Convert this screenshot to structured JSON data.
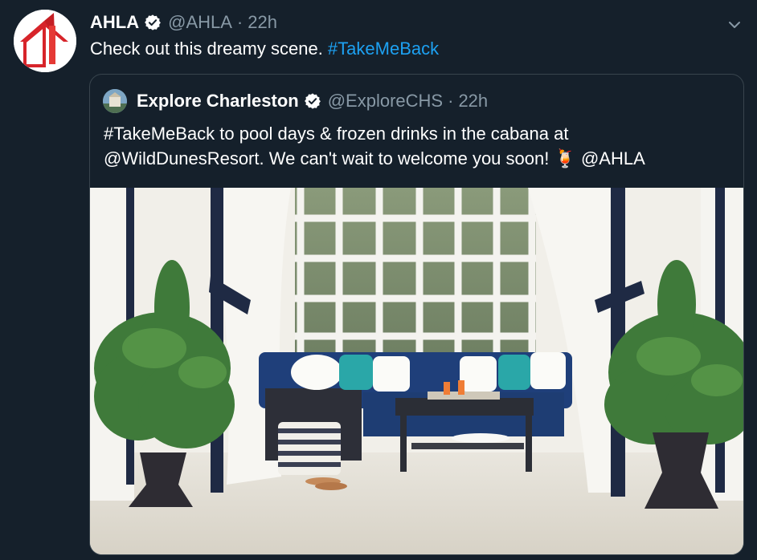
{
  "tweet": {
    "author_name": "AHLA",
    "handle": "@AHLA",
    "separator": "·",
    "time": "22h",
    "text_plain": "Check out this dreamy scene. ",
    "text_hashtag": "#TakeMeBack",
    "avatar_icon": "ahla-logo-icon",
    "verified_icon": "verified-badge-icon",
    "menu_icon": "chevron-down-icon"
  },
  "quote": {
    "author_name": "Explore Charleston",
    "handle": "@ExploreCHS",
    "separator": "·",
    "time": "22h",
    "line1": "#TakeMeBack to pool days & frozen drinks in the cabana at",
    "line2_text": "@WildDunesResort. We can't wait to welcome you soon! 🍹 ",
    "line2_mention": "@AHLA",
    "media_icon": "cabana-photo"
  },
  "colors": {
    "background": "#15202b",
    "text": "#ffffff",
    "secondary": "#8899a6",
    "link": "#1da1f2",
    "border": "#38444d"
  }
}
